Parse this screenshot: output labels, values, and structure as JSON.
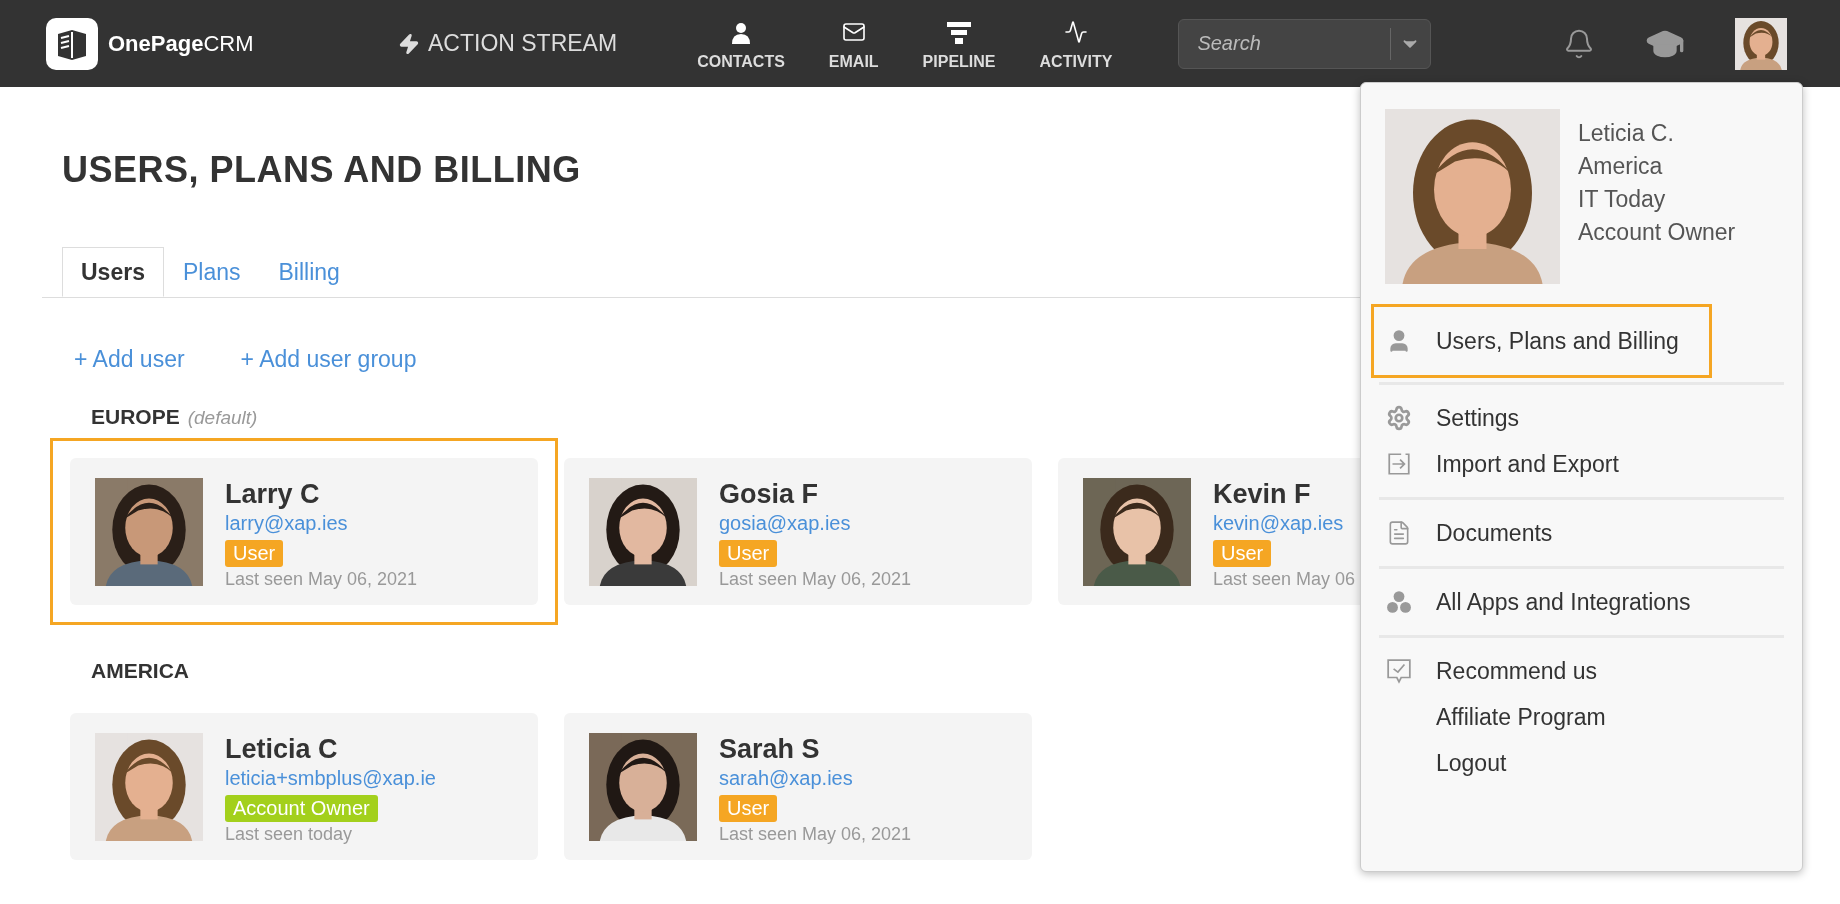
{
  "header": {
    "logo": {
      "bold": "OnePage",
      "light": "CRM"
    },
    "action_stream": "ACTION STREAM",
    "nav": [
      {
        "kind": "contacts",
        "label": "CONTACTS"
      },
      {
        "kind": "email",
        "label": "EMAIL"
      },
      {
        "kind": "pipeline",
        "label": "PIPELINE"
      },
      {
        "kind": "activity",
        "label": "ACTIVITY"
      }
    ],
    "search": {
      "placeholder": "Search"
    }
  },
  "page": {
    "title": "USERS, PLANS AND BILLING",
    "tabs": [
      {
        "label": "Users",
        "selected": true
      },
      {
        "label": "Plans",
        "selected": false
      },
      {
        "label": "Billing",
        "selected": false
      }
    ],
    "actions": [
      "+ Add user",
      "+ Add user group"
    ],
    "groups": [
      {
        "name": "EUROPE",
        "note": "(default)",
        "users": [
          {
            "name": "Larry C",
            "email": "larry@xap.ies",
            "role": "User",
            "color": "#f5a623",
            "last_seen": "Last seen May 06, 2021",
            "highlighted": true
          },
          {
            "name": "Gosia F",
            "email": "gosia@xap.ies",
            "role": "User",
            "color": "#f5a623",
            "last_seen": "Last seen May 06, 2021",
            "highlighted": false
          },
          {
            "name": "Kevin F",
            "email": "kevin@xap.ies",
            "role": "User",
            "color": "#f5a623",
            "last_seen": "Last seen May 06",
            "highlighted": false
          }
        ]
      },
      {
        "name": "AMERICA",
        "users": [
          {
            "name": "Leticia C",
            "email": "leticia+smbplus@xap.ie",
            "role": "Account Owner",
            "color": "#a3d01c",
            "last_seen": "Last seen today",
            "highlighted": false
          },
          {
            "name": "Sarah S",
            "email": "sarah@xap.ies",
            "role": "User",
            "color": "#f5a623",
            "last_seen": "Last seen May 06, 2021",
            "highlighted": false
          }
        ]
      }
    ]
  },
  "profile_menu": {
    "details": [
      "Leticia C.",
      "America",
      "IT Today",
      "Account Owner"
    ],
    "sections": [
      [
        {
          "kind": "user",
          "label": "Users, Plans and Billing",
          "highlighted": true
        }
      ],
      [
        {
          "kind": "gear",
          "label": "Settings",
          "highlighted": false
        },
        {
          "kind": "import",
          "label": "Import and Export",
          "highlighted": false
        }
      ],
      [
        {
          "kind": "document",
          "label": "Documents",
          "highlighted": false
        }
      ],
      [
        {
          "kind": "apps",
          "label": "All Apps and Integrations",
          "highlighted": false
        }
      ],
      [
        {
          "kind": "recommend",
          "label": "Recommend us",
          "highlighted": false
        },
        {
          "kind": "plain",
          "label": "Affiliate Program",
          "highlighted": false
        },
        {
          "kind": "plain",
          "label": "Logout",
          "highlighted": false
        }
      ]
    ]
  }
}
